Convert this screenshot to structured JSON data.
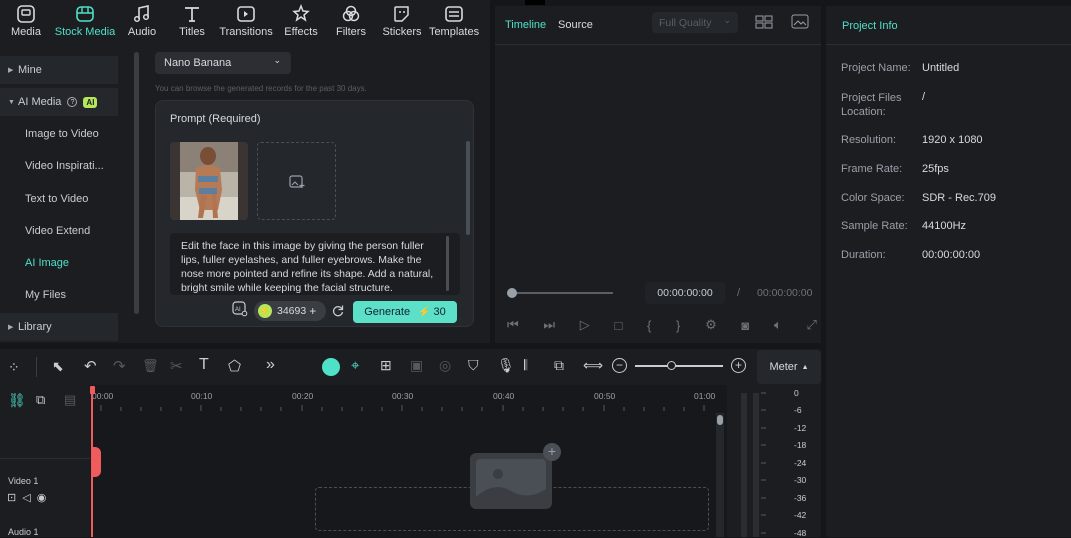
{
  "toolbar": {
    "tabs": [
      {
        "label": "Media",
        "icon": "media-icon"
      },
      {
        "label": "Stock Media",
        "icon": "stock-media-icon"
      },
      {
        "label": "Audio",
        "icon": "music-note-icon"
      },
      {
        "label": "Titles",
        "icon": "titles-t-icon"
      },
      {
        "label": "Transitions",
        "icon": "transitions-icon"
      },
      {
        "label": "Effects",
        "icon": "effects-star-icon"
      },
      {
        "label": "Filters",
        "icon": "filters-icon"
      },
      {
        "label": "Stickers",
        "icon": "sticker-icon"
      },
      {
        "label": "Templates",
        "icon": "templates-icon"
      }
    ],
    "active": "Stock Media",
    "accent": "#4fe1c7"
  },
  "sidebar": {
    "items": [
      {
        "label": "Mine",
        "type": "group"
      },
      {
        "label": "AI Media",
        "type": "group",
        "badge": "AI"
      },
      {
        "label": "Image to Video"
      },
      {
        "label": "Video Inspirati..."
      },
      {
        "label": "Text to Video"
      },
      {
        "label": "Video Extend"
      },
      {
        "label": "AI Image",
        "active": true
      },
      {
        "label": "My Files"
      },
      {
        "label": "Library",
        "type": "group"
      }
    ]
  },
  "content": {
    "model_select": "Nano Banana",
    "hint": "You can browse the generated records for the past 30 days.",
    "prompt_label": "Prompt (Required)",
    "prompt_text": "Edit the face in this image by giving the person fuller lips, fuller eyelashes, and fuller eyebrows. Make the nose more pointed and refine its shape. Add a natural, bright smile while keeping the facial structure.",
    "credits": "34693",
    "generate_label": "Generate",
    "generate_cost": "30"
  },
  "preview": {
    "tabs": [
      "Timeline",
      "Source"
    ],
    "quality": "Full Quality",
    "time_current": "00:00:00:00",
    "time_sep": "/",
    "time_total": "00:00:00:00"
  },
  "info": {
    "title": "Project Info",
    "rows": [
      {
        "k": "Project Name:",
        "v": "Untitled"
      },
      {
        "k": "Project Files Location:",
        "v": "/"
      },
      {
        "k": "Resolution:",
        "v": "1920 x 1080"
      },
      {
        "k": "Frame Rate:",
        "v": "25fps"
      },
      {
        "k": "Color Space:",
        "v": "SDR - Rec.709"
      },
      {
        "k": "Sample Rate:",
        "v": "44100Hz"
      },
      {
        "k": "Duration:",
        "v": "00:00:00:00"
      }
    ]
  },
  "timeline": {
    "meter_label": "Meter",
    "ruler": [
      "00:00",
      "00:10",
      "00:20",
      "00:30",
      "00:40",
      "00:50",
      "01:00"
    ],
    "tracks": [
      "Video 1",
      "Audio 1"
    ],
    "meter_scale": [
      "0",
      "-6",
      "-12",
      "-18",
      "-24",
      "-30",
      "-36",
      "-42",
      "-48"
    ]
  }
}
